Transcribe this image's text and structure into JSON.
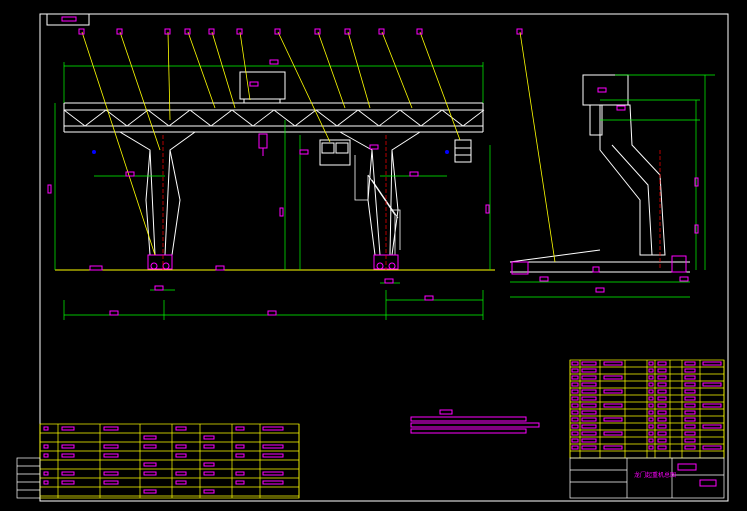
{
  "colors": {
    "background": "#000000",
    "frame": "#ffffff",
    "structure": "#ffffff",
    "dimension": "#00ff00",
    "leader": "#ffff00",
    "label": "#ff00ff",
    "table": "#ffff00",
    "centerline": "#ff0000",
    "marker": "#0000ff"
  },
  "title_block": {
    "drawing_name": "龙门起重机总图"
  },
  "icons": {
    "gantry_crane_front_view": "gantry-crane-front-view",
    "gantry_crane_side_view": "gantry-crane-side-view"
  }
}
